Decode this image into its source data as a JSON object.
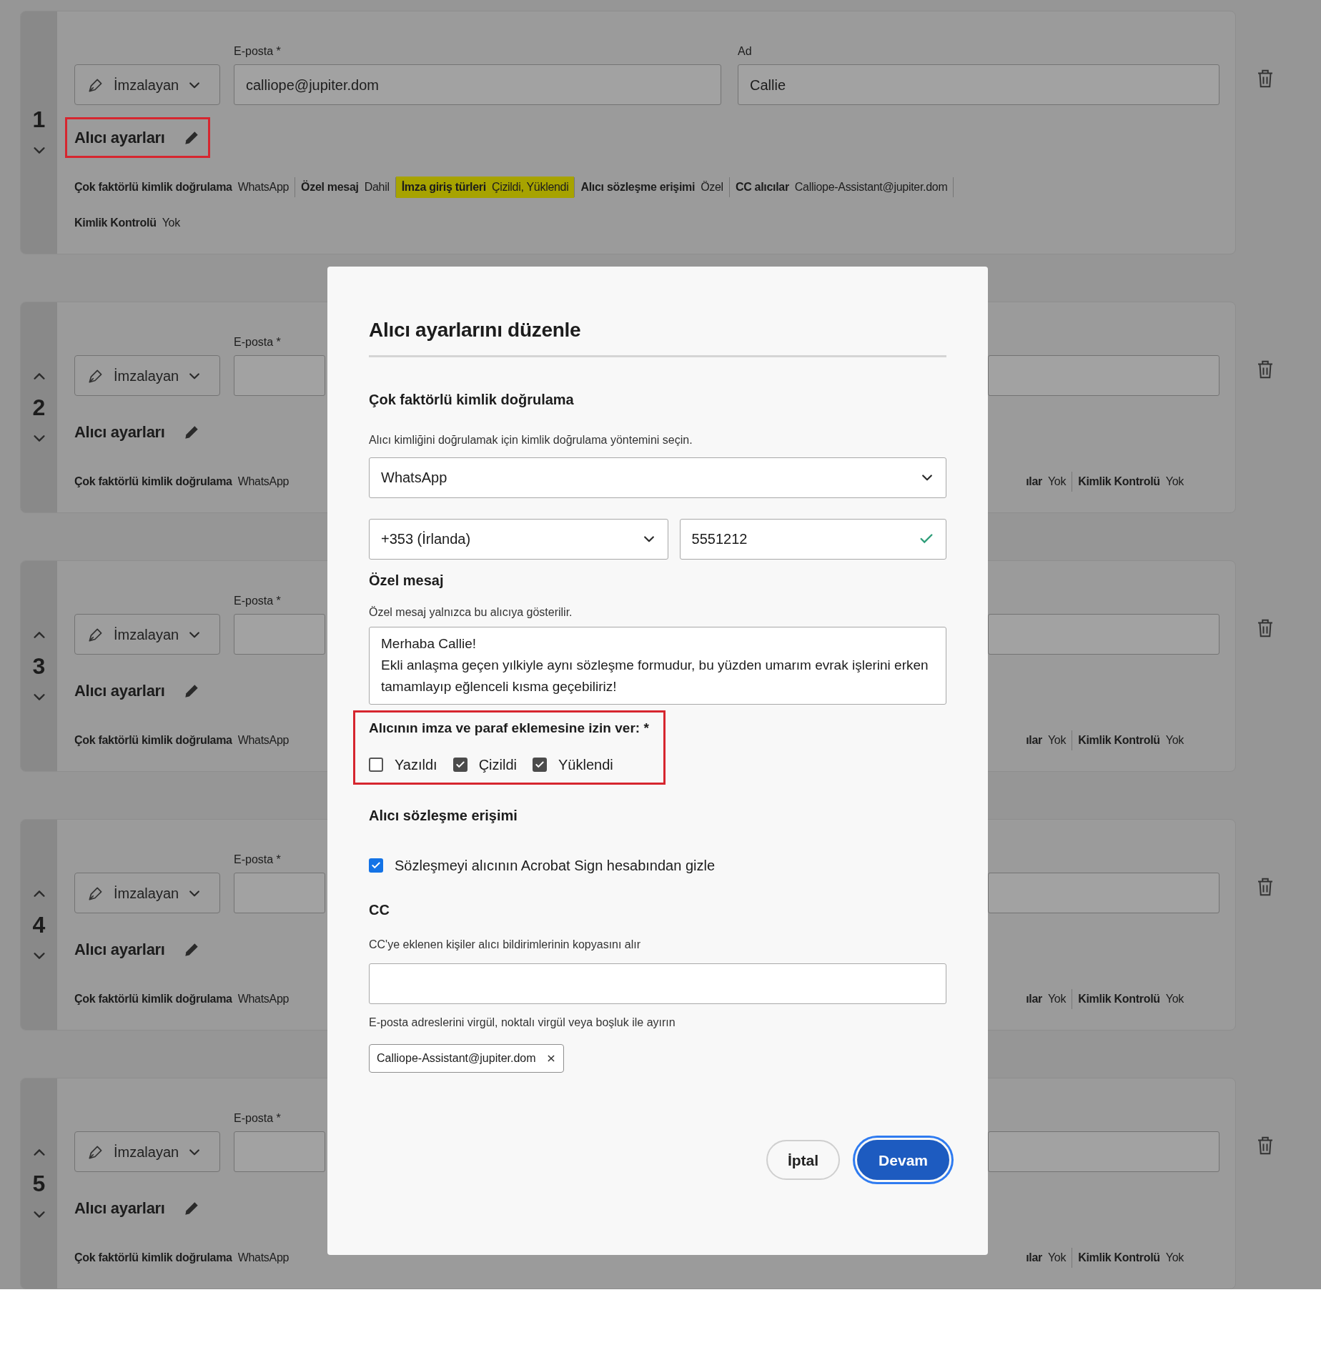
{
  "recipients": [
    {
      "number": "1",
      "move_up": false,
      "move_down": true,
      "role": "İmzalayan",
      "email_label": "E-posta",
      "email_required": "*",
      "email": "calliope@jupiter.dom",
      "name_label": "Ad",
      "name": "Callie",
      "settings_label": "Alıcı ayarları",
      "settings_outlined": true,
      "covered": false,
      "summary_lines": [
        [
          {
            "label": "Çok faktörlü kimlik doğrulama",
            "value": "WhatsApp",
            "highlighted": false
          },
          {
            "label": "Özel mesaj",
            "value": "Dahil",
            "highlighted": false
          },
          {
            "label": "İmza giriş türleri",
            "value": "Çizildi, Yüklendi",
            "highlighted": true
          },
          {
            "label": "Alıcı sözleşme erişimi",
            "value": "Özel",
            "highlighted": false
          },
          {
            "label": "CC alıcılar",
            "value": "Calliope-Assistant@jupiter.dom",
            "highlighted": false
          }
        ],
        [
          {
            "label": "Kimlik Kontrolü",
            "value": "Yok",
            "highlighted": false
          }
        ]
      ]
    },
    {
      "number": "2",
      "move_up": true,
      "move_down": true,
      "role": "İmzalayan",
      "email_label": "E-posta",
      "email_required": "*",
      "settings_label": "Alıcı ayarları",
      "settings_outlined": false,
      "covered": true,
      "summary_lines": [
        [
          {
            "label": "Çok faktörlü kimlik doğrulama",
            "value": "WhatsApp",
            "highlighted": false
          }
        ]
      ],
      "summary_right": [
        {
          "label": "ılar",
          "value": "Yok",
          "highlighted": false
        },
        {
          "label": "Kimlik Kontrolü",
          "value": "Yok",
          "highlighted": false
        }
      ]
    },
    {
      "number": "3",
      "move_up": true,
      "move_down": true,
      "role": "İmzalayan",
      "email_label": "E-posta",
      "email_required": "*",
      "settings_label": "Alıcı ayarları",
      "settings_outlined": false,
      "covered": true,
      "summary_lines": [
        [
          {
            "label": "Çok faktörlü kimlik doğrulama",
            "value": "WhatsApp",
            "highlighted": false
          }
        ]
      ],
      "summary_right": [
        {
          "label": "ılar",
          "value": "Yok",
          "highlighted": false
        },
        {
          "label": "Kimlik Kontrolü",
          "value": "Yok",
          "highlighted": false
        }
      ]
    },
    {
      "number": "4",
      "move_up": true,
      "move_down": true,
      "role": "İmzalayan",
      "email_label": "E-posta",
      "email_required": "*",
      "settings_label": "Alıcı ayarları",
      "settings_outlined": false,
      "covered": true,
      "summary_lines": [
        [
          {
            "label": "Çok faktörlü kimlik doğrulama",
            "value": "WhatsApp",
            "highlighted": false
          }
        ]
      ],
      "summary_right": [
        {
          "label": "ılar",
          "value": "Yok",
          "highlighted": false
        },
        {
          "label": "Kimlik Kontrolü",
          "value": "Yok",
          "highlighted": false
        }
      ]
    },
    {
      "number": "5",
      "move_up": true,
      "move_down": true,
      "role": "İmzalayan",
      "email_label": "E-posta",
      "email_required": "*",
      "settings_label": "Alıcı ayarları",
      "settings_outlined": false,
      "covered": true,
      "summary_lines": [
        [
          {
            "label": "Çok faktörlü kimlik doğrulama",
            "value": "WhatsApp",
            "highlighted": false
          }
        ]
      ],
      "summary_right": [
        {
          "label": "ılar",
          "value": "Yok",
          "highlighted": false
        },
        {
          "label": "Kimlik Kontrolü",
          "value": "Yok",
          "highlighted": false
        }
      ]
    }
  ],
  "dialog": {
    "title": "Alıcı ayarlarını düzenle",
    "mfa": {
      "heading": "Çok faktörlü kimlik doğrulama",
      "help": "Alıcı kimliğini doğrulamak için kimlik doğrulama yöntemini seçin.",
      "method": "WhatsApp",
      "country": "+353 (İrlanda)",
      "phone": "5551212",
      "phone_valid": true
    },
    "message": {
      "heading": "Özel mesaj",
      "help": "Özel mesaj yalnızca bu alıcıya gösterilir.",
      "text": "Merhaba Callie!\nEkli anlaşma geçen yılkiyle aynı sözleşme formudur, bu yüzden umarım evrak işlerini erken tamamlayıp eğlenceli kısma geçebiliriz!"
    },
    "signature_types": {
      "label": "Alıcının imza ve paraf eklemesine izin ver:",
      "required": "*",
      "outlined": true,
      "options": [
        {
          "label": "Yazıldı",
          "checked": false
        },
        {
          "label": "Çizildi",
          "checked": true
        },
        {
          "label": "Yüklendi",
          "checked": true
        }
      ]
    },
    "access": {
      "heading": "Alıcı sözleşme erişimi",
      "options": [
        {
          "label": "Sözleşmeyi alıcının Acrobat Sign hesabından gizle",
          "checked": true
        }
      ]
    },
    "cc": {
      "heading": "CC",
      "help": "CC'ye eklenen kişiler alıcı bildirimlerinin kopyasını alır",
      "hint": "E-posta adreslerini virgül, noktalı virgül veya boşluk ile ayırın",
      "chips": [
        "Calliope-Assistant@jupiter.dom"
      ]
    },
    "buttons": [
      {
        "label": "İptal",
        "kind": "secondary"
      },
      {
        "label": "Devam",
        "kind": "primary"
      }
    ]
  }
}
